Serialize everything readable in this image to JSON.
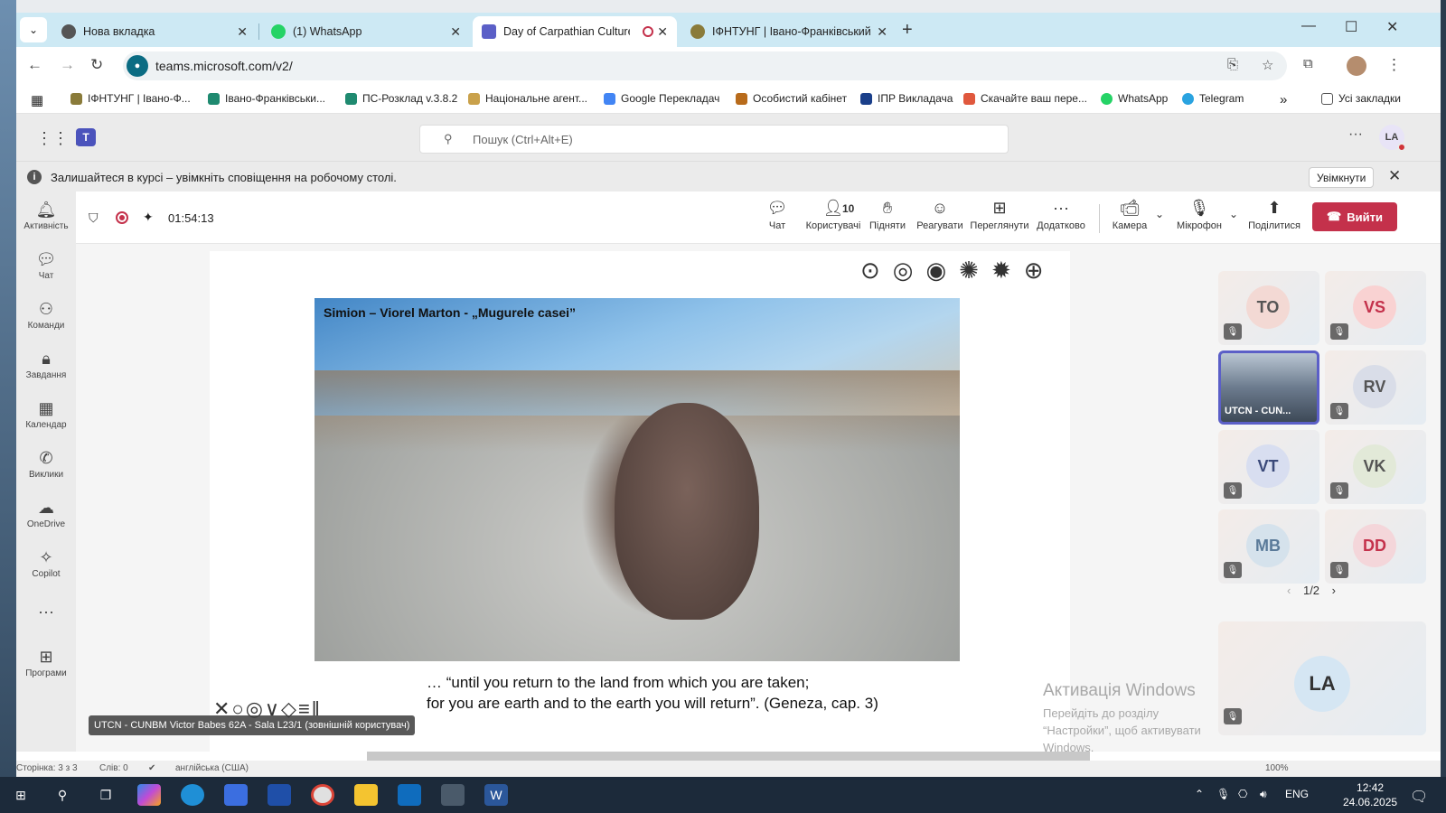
{
  "browser": {
    "tabs": [
      {
        "title": "Нова вкладка"
      },
      {
        "title": "(1) WhatsApp"
      },
      {
        "title": "Day of Carpathian Culture C"
      },
      {
        "title": "ІФНТУНГ | Івано-Франківський"
      }
    ],
    "url": "teams.microsoft.com/v2/",
    "bookmarks": [
      "ІФНТУНГ | Івано-Ф...",
      "Івано-Франківськи...",
      "ПС-Розклад v.3.8.2",
      "Національне агент...",
      "Google Перекладач",
      "Особистий кабінет",
      "ІПР Викладача",
      "Скачайте ваш пере...",
      "WhatsApp",
      "Telegram"
    ],
    "all_bookmarks": "Усі закладки",
    "more_bookmarks": "»"
  },
  "teams": {
    "search_placeholder": "Пошук (Ctrl+Alt+E)",
    "user_initials": "LA",
    "notification": {
      "text": "Залишайтеся в курсі – увімкніть сповіщення на робочому столі.",
      "button": "Увімкнути"
    },
    "rail": [
      {
        "label": "Активність",
        "icon": "bell-icon"
      },
      {
        "label": "Чат",
        "icon": "chat-icon"
      },
      {
        "label": "Команди",
        "icon": "teams-icon"
      },
      {
        "label": "Завдання",
        "icon": "tasks-icon"
      },
      {
        "label": "Календар",
        "icon": "calendar-icon"
      },
      {
        "label": "Виклики",
        "icon": "phone-icon"
      },
      {
        "label": "OneDrive",
        "icon": "cloud-icon"
      },
      {
        "label": "Copilot",
        "icon": "copilot-icon"
      },
      {
        "label": "",
        "icon": "more-icon"
      },
      {
        "label": "Програми",
        "icon": "apps-icon"
      }
    ],
    "meeting": {
      "timer": "01:54:13",
      "controls": {
        "chat": "Чат",
        "people": "Користувачі",
        "people_count": "10",
        "raise": "Підняти",
        "react": "Реагувати",
        "view": "Переглянути",
        "more": "Додатково",
        "camera": "Камера",
        "mic": "Мікрофон",
        "share": "Поділитися",
        "leave": "Вийти"
      },
      "slide": {
        "caption": "Simion – Viorel Marton - „Mugurele casei”",
        "quote_line1": "… “until you return to the land from which you are taken;",
        "quote_line2": "for you are earth and to the earth you will return”. (Geneza, cap. 3)"
      },
      "presenter_label": "UTCN - CUNBM Victor Babes 62A - Sala L23/1 (зовнішній користувач)",
      "participants": [
        {
          "initials": "TO",
          "color": "#f3d9d4"
        },
        {
          "initials": "VS",
          "color": "#f9d2d2"
        },
        {
          "initials": "UTCN - CUN...",
          "video": true
        },
        {
          "initials": "RV",
          "color": "#d9dde8"
        },
        {
          "initials": "VT",
          "color": "#d8def0"
        },
        {
          "initials": "VK",
          "color": "#e2e9d8"
        },
        {
          "initials": "MB",
          "color": "#d5e2ec"
        },
        {
          "initials": "DD",
          "color": "#f4d6da"
        }
      ],
      "pager": "1/2",
      "self": {
        "initials": "LA",
        "color": "#d5e6f3"
      }
    },
    "watermark_title": "Активація Windows",
    "watermark_text": "Перейдіть до розділу “Настройки”, щоб активувати Windows."
  },
  "word_status": {
    "page": "Сторінка: 3 з 3",
    "words": "Слів: 0",
    "lang": "англійська (США)",
    "zoom": "100%"
  },
  "taskbar": {
    "lang": "ENG",
    "time": "12:42",
    "date": "24.06.2025"
  }
}
